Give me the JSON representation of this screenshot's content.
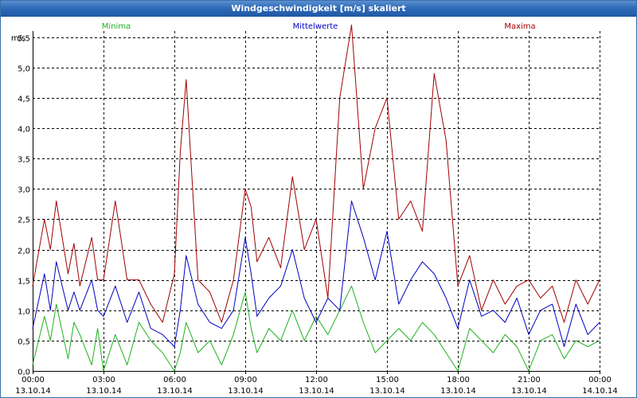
{
  "window": {
    "title": "Windgeschwindigkeit [m/s] skaliert"
  },
  "colors": {
    "minima": "#1fb11f",
    "mittelwerte": "#0000c0",
    "maxima": "#a00000",
    "grid": "#000000"
  },
  "chart_data": {
    "type": "line",
    "title": "Windgeschwindigkeit [m/s] skaliert",
    "ylabel": "m/s",
    "ylim": [
      0,
      5.6
    ],
    "yticks": [
      0,
      0.5,
      1.0,
      1.5,
      2.0,
      2.5,
      3.0,
      3.5,
      4.0,
      4.5,
      5.0,
      5.5
    ],
    "ytick_labels": [
      "0,0",
      "0,5",
      "1,0",
      "1,5",
      "2,0",
      "2,5",
      "3,0",
      "3,5",
      "4,0",
      "4,5",
      "5,0",
      "5,5"
    ],
    "xlim": [
      0,
      24
    ],
    "xticks": [
      0,
      3,
      6,
      9,
      12,
      15,
      18,
      21,
      24
    ],
    "xtick_time_labels": [
      "00:00",
      "03:00",
      "06:00",
      "09:00",
      "12:00",
      "15:00",
      "18:00",
      "21:00",
      "00:00"
    ],
    "xtick_date_labels": [
      "13.10.14",
      "13.10.14",
      "13.10.14",
      "13.10.14",
      "13.10.14",
      "13.10.14",
      "13.10.14",
      "13.10.14",
      "14.10.14"
    ],
    "grid": true,
    "legend_position": "top",
    "series": [
      {
        "name": "Minima",
        "x": [
          0,
          0.5,
          0.75,
          1,
          1.5,
          1.75,
          2,
          2.5,
          2.75,
          3,
          3.5,
          4,
          4.5,
          5,
          5.5,
          6,
          6.25,
          6.5,
          7,
          7.5,
          8,
          8.5,
          9,
          9.25,
          9.5,
          10,
          10.5,
          11,
          11.5,
          12,
          12.5,
          13,
          13.5,
          14,
          14.5,
          15,
          15.5,
          16,
          16.5,
          17,
          17.5,
          18,
          18.5,
          19,
          19.5,
          20,
          20.5,
          21,
          21.5,
          22,
          22.5,
          23,
          23.5,
          24
        ],
        "y": [
          0.1,
          0.9,
          0.5,
          1.1,
          0.2,
          0.8,
          0.6,
          0.1,
          0.7,
          0.0,
          0.6,
          0.1,
          0.8,
          0.5,
          0.3,
          0.0,
          0.3,
          0.8,
          0.3,
          0.5,
          0.1,
          0.6,
          1.3,
          0.7,
          0.3,
          0.7,
          0.5,
          1.0,
          0.5,
          0.9,
          0.6,
          1.0,
          1.4,
          0.8,
          0.3,
          0.5,
          0.7,
          0.5,
          0.8,
          0.6,
          0.3,
          0.0,
          0.7,
          0.5,
          0.3,
          0.6,
          0.4,
          0.0,
          0.5,
          0.6,
          0.2,
          0.5,
          0.4,
          0.5
        ]
      },
      {
        "name": "Mittelwerte",
        "x": [
          0,
          0.5,
          0.75,
          1,
          1.5,
          1.75,
          2,
          2.5,
          2.75,
          3,
          3.5,
          4,
          4.5,
          5,
          5.5,
          6,
          6.25,
          6.5,
          7,
          7.5,
          8,
          8.5,
          9,
          9.25,
          9.5,
          10,
          10.5,
          11,
          11.5,
          12,
          12.5,
          13,
          13.5,
          14,
          14.5,
          15,
          15.5,
          16,
          16.5,
          17,
          17.5,
          18,
          18.5,
          19,
          19.5,
          20,
          20.5,
          21,
          21.5,
          22,
          22.5,
          23,
          23.5,
          24
        ],
        "y": [
          0.7,
          1.6,
          1.0,
          1.8,
          1.0,
          1.3,
          1.0,
          1.5,
          1.0,
          0.9,
          1.4,
          0.8,
          1.3,
          0.7,
          0.6,
          0.4,
          1.0,
          1.9,
          1.1,
          0.8,
          0.7,
          1.0,
          2.2,
          1.6,
          0.9,
          1.2,
          1.4,
          2.0,
          1.2,
          0.8,
          1.2,
          1.0,
          2.8,
          2.2,
          1.5,
          2.3,
          1.1,
          1.5,
          1.8,
          1.6,
          1.2,
          0.7,
          1.5,
          0.9,
          1.0,
          0.8,
          1.2,
          0.6,
          1.0,
          1.1,
          0.4,
          1.1,
          0.6,
          0.8
        ]
      },
      {
        "name": "Maxima",
        "x": [
          0,
          0.5,
          0.75,
          1,
          1.5,
          1.75,
          2,
          2.5,
          2.75,
          3,
          3.5,
          4,
          4.5,
          5,
          5.5,
          6,
          6.25,
          6.5,
          7,
          7.5,
          8,
          8.5,
          9,
          9.25,
          9.5,
          10,
          10.5,
          11,
          11.5,
          12,
          12.5,
          13,
          13.5,
          14,
          14.5,
          15,
          15.5,
          16,
          16.5,
          17,
          17.5,
          18,
          18.5,
          19,
          19.5,
          20,
          20.5,
          21,
          21.5,
          22,
          22.5,
          23,
          23.5,
          24
        ],
        "y": [
          1.4,
          2.5,
          2.0,
          2.8,
          1.6,
          2.1,
          1.4,
          2.2,
          1.5,
          1.5,
          2.8,
          1.5,
          1.5,
          1.1,
          0.8,
          1.6,
          3.6,
          4.8,
          1.5,
          1.3,
          0.8,
          1.5,
          3.0,
          2.7,
          1.8,
          2.2,
          1.7,
          3.2,
          2.0,
          2.5,
          1.2,
          4.5,
          5.7,
          3.0,
          4.0,
          4.5,
          2.5,
          2.8,
          2.3,
          4.9,
          3.8,
          1.4,
          1.9,
          1.0,
          1.5,
          1.1,
          1.4,
          1.5,
          1.2,
          1.4,
          0.8,
          1.5,
          1.1,
          1.5
        ]
      }
    ]
  }
}
